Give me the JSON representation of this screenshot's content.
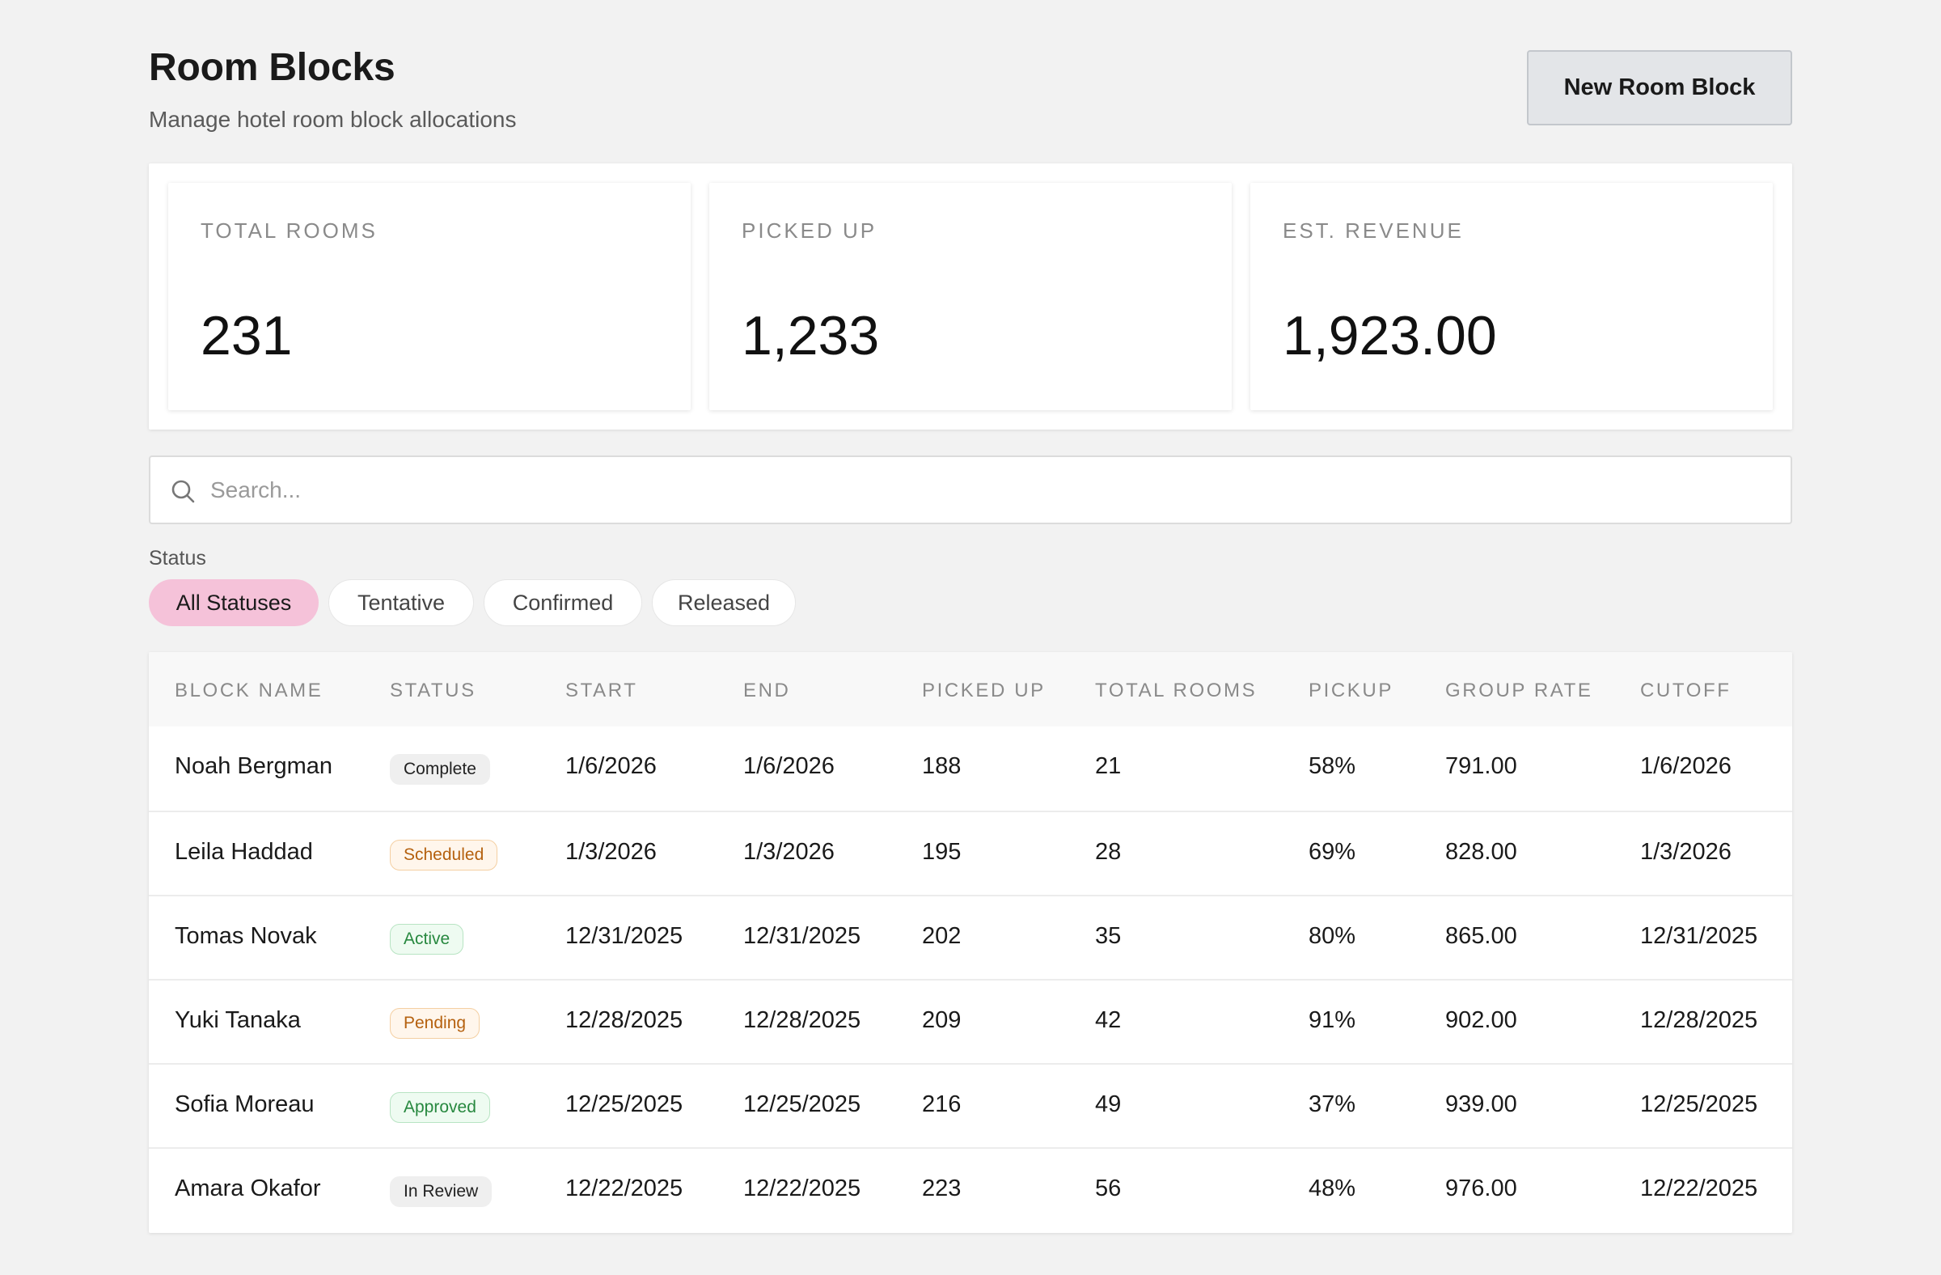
{
  "header": {
    "title": "Room Blocks",
    "subtitle": "Manage hotel room block allocations",
    "new_button_label": "New Room Block"
  },
  "stats": [
    {
      "label": "TOTAL ROOMS",
      "value": "231"
    },
    {
      "label": "PICKED UP",
      "value": "1,233"
    },
    {
      "label": "EST. REVENUE",
      "value": "1,923.00"
    }
  ],
  "search": {
    "placeholder": "Search...",
    "value": "",
    "icon": "search-icon"
  },
  "filters": {
    "label": "Status",
    "options": [
      "All Statuses",
      "Tentative",
      "Confirmed",
      "Released"
    ],
    "selected": "All Statuses",
    "active_color": "#f5c2d9"
  },
  "table": {
    "columns": [
      "BLOCK NAME",
      "STATUS",
      "START",
      "END",
      "PICKED UP",
      "TOTAL ROOMS",
      "PICKUP",
      "GROUP RATE",
      "CUTOFF"
    ],
    "rows": [
      {
        "name": "Noah Bergman",
        "status": "Complete",
        "status_style": "neutral",
        "start": "1/6/2026",
        "end": "1/6/2026",
        "picked_up": "188",
        "total_rooms": "21",
        "pickup": "58%",
        "group_rate": "791.00",
        "cutoff": "1/6/2026"
      },
      {
        "name": "Leila Haddad",
        "status": "Scheduled",
        "status_style": "orange",
        "start": "1/3/2026",
        "end": "1/3/2026",
        "picked_up": "195",
        "total_rooms": "28",
        "pickup": "69%",
        "group_rate": "828.00",
        "cutoff": "1/3/2026"
      },
      {
        "name": "Tomas Novak",
        "status": "Active",
        "status_style": "green",
        "start": "12/31/2025",
        "end": "12/31/2025",
        "picked_up": "202",
        "total_rooms": "35",
        "pickup": "80%",
        "group_rate": "865.00",
        "cutoff": "12/31/2025"
      },
      {
        "name": "Yuki Tanaka",
        "status": "Pending",
        "status_style": "orange",
        "start": "12/28/2025",
        "end": "12/28/2025",
        "picked_up": "209",
        "total_rooms": "42",
        "pickup": "91%",
        "group_rate": "902.00",
        "cutoff": "12/28/2025"
      },
      {
        "name": "Sofia Moreau",
        "status": "Approved",
        "status_style": "green",
        "start": "12/25/2025",
        "end": "12/25/2025",
        "picked_up": "216",
        "total_rooms": "49",
        "pickup": "37%",
        "group_rate": "939.00",
        "cutoff": "12/25/2025"
      },
      {
        "name": "Amara Okafor",
        "status": "In Review",
        "status_style": "neutral",
        "start": "12/22/2025",
        "end": "12/22/2025",
        "picked_up": "223",
        "total_rooms": "56",
        "pickup": "48%",
        "group_rate": "976.00",
        "cutoff": "12/22/2025"
      }
    ]
  }
}
